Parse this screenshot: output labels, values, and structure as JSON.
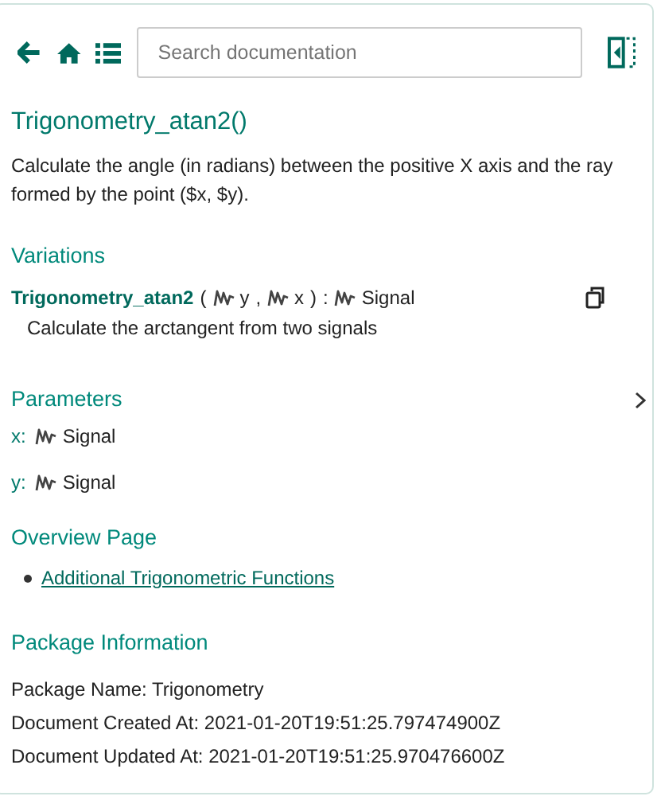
{
  "toolbar": {
    "search": {
      "placeholder": "Search documentation"
    }
  },
  "title": "Trigonometry_atan2()",
  "description": "Calculate the angle (in radians) between the positive X axis and the ray formed by the point ($x, $y).",
  "variations": {
    "heading": "Variations",
    "items": [
      {
        "signature": [
          {
            "kind": "name",
            "text": "Trigonometry_atan2"
          },
          {
            "kind": "punct",
            "text": "("
          },
          {
            "kind": "signal",
            "text": "y"
          },
          {
            "kind": "punct",
            "text": ","
          },
          {
            "kind": "signal",
            "text": "x"
          },
          {
            "kind": "punct",
            "text": ")"
          },
          {
            "kind": "punct",
            "text": ":"
          },
          {
            "kind": "signal",
            "text": "Signal"
          }
        ],
        "description": "Calculate the arctangent from two signals"
      }
    ]
  },
  "parameters": {
    "heading": "Parameters",
    "items": [
      {
        "label": "x:",
        "type": "Signal"
      },
      {
        "label": "y:",
        "type": "Signal"
      }
    ]
  },
  "overview": {
    "heading": "Overview Page",
    "links": [
      "Additional Trigonometric Functions"
    ]
  },
  "package": {
    "heading": "Package Information",
    "lines": [
      "Package Name: Trigonometry",
      "Document Created At: 2021-01-20T19:51:25.797474900Z",
      "Document Updated At: 2021-01-20T19:51:25.970476600Z"
    ]
  }
}
